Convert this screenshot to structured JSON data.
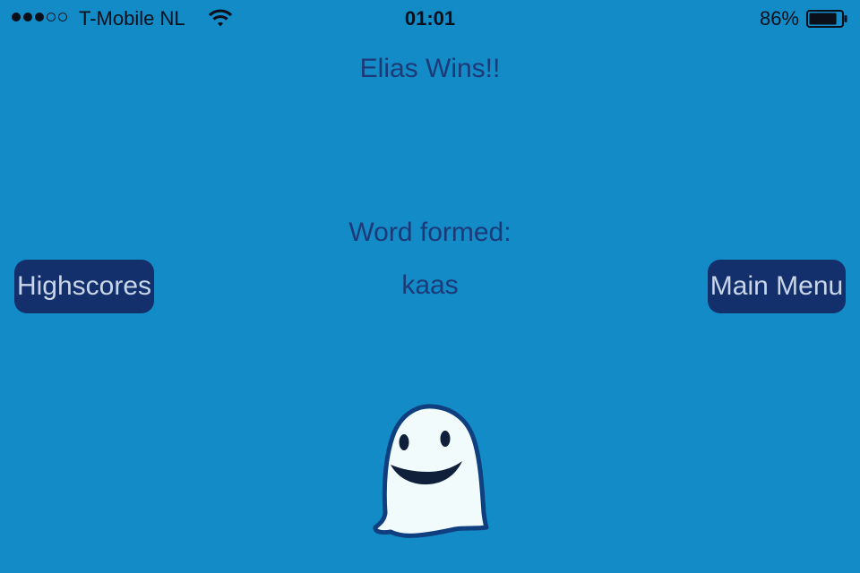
{
  "status_bar": {
    "signal_bars_filled": 3,
    "signal_bars_total": 5,
    "carrier": "T-Mobile NL",
    "time": "01:01",
    "battery_percent": "86%",
    "battery_level": 0.86,
    "wifi_icon": "wifi-icon",
    "battery_icon": "battery-icon"
  },
  "result": {
    "title": "Elias Wins!!",
    "word_heading": "Word formed:",
    "word": "kaas"
  },
  "buttons": {
    "highscores_label": "Highscores",
    "main_menu_label": "Main Menu"
  },
  "mascot": {
    "icon": "ghost-icon"
  },
  "colors": {
    "background": "#128bc6",
    "text": "#1c3a78",
    "button": "#14306c",
    "button_text": "#c9d6e8"
  }
}
